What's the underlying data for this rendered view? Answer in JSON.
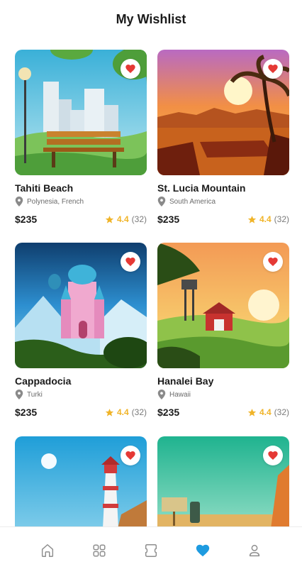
{
  "header": {
    "title": "My Wishlist"
  },
  "cards": [
    {
      "name": "Tahiti Beach",
      "location": "Polynesia, French",
      "price": "$235",
      "rating": "4.4",
      "reviews": "(32)"
    },
    {
      "name": "St. Lucia Mountain",
      "location": "South America",
      "price": "$235",
      "rating": "4.4",
      "reviews": "(32)"
    },
    {
      "name": "Cappadocia",
      "location": "Turki",
      "price": "$235",
      "rating": "4.4",
      "reviews": "(32)"
    },
    {
      "name": "Hanalei Bay",
      "location": "Hawaii",
      "price": "$235",
      "rating": "4.4",
      "reviews": "(32)"
    }
  ],
  "bottom_nav": {
    "items": [
      "home-icon",
      "grid-icon",
      "ticket-icon",
      "heart-icon",
      "user-icon"
    ],
    "active": "heart-icon"
  },
  "colors": {
    "accent": "#1e9be0",
    "heart": "#e53935",
    "star": "#f0b429"
  }
}
